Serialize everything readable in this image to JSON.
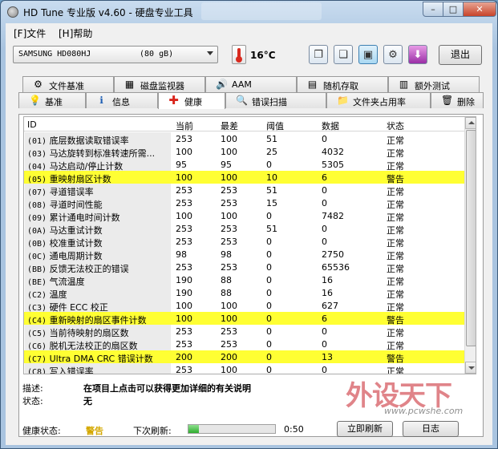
{
  "window": {
    "title": "HD Tune 专业版 v4.60 - 硬盘专业工具",
    "minimize": "–",
    "maximize": "□",
    "close": "✕"
  },
  "menu": [
    {
      "label": "[F]文件"
    },
    {
      "label": "[H]帮助"
    }
  ],
  "toolbar": {
    "drive": {
      "name": "SAMSUNG HD080HJ",
      "size": "(80 gB)"
    },
    "temperature": "16°C",
    "buttons": [
      {
        "name": "copy-text-icon",
        "glyph": "❐"
      },
      {
        "name": "copy-screenshot-icon",
        "glyph": "❏"
      },
      {
        "name": "save-icon",
        "glyph": "▣"
      },
      {
        "name": "options-icon",
        "glyph": "⚙"
      },
      {
        "name": "download-icon",
        "glyph": "⬇"
      }
    ],
    "exit_label": "退出"
  },
  "tabs_top": [
    {
      "label": "文件基准",
      "icon": "⚙"
    },
    {
      "label": "磁盘监视器",
      "icon": "▦"
    },
    {
      "label": "AAM",
      "icon": "🔊"
    },
    {
      "label": "随机存取",
      "icon": "▤"
    },
    {
      "label": "额外测试",
      "icon": "▥"
    }
  ],
  "tabs_bottom": [
    {
      "label": "基准",
      "icon": "💡"
    },
    {
      "label": "信息",
      "icon": "ℹ"
    },
    {
      "label": "健康",
      "icon": "✚"
    },
    {
      "label": "错误扫描",
      "icon": "🔍"
    },
    {
      "label": "文件夹占用率",
      "icon": "📁"
    },
    {
      "label": "删除",
      "icon": "🗑"
    }
  ],
  "colors": {
    "warning_row": "#ffff33",
    "health_warning_text": "#d4a800"
  },
  "table": {
    "headers": {
      "id": "ID",
      "current": "当前",
      "worst": "最差",
      "threshold": "阈值",
      "data": "数据",
      "status": "状态"
    },
    "rows": [
      {
        "id": "(01)",
        "name": "底层数据读取错误率",
        "current": "253",
        "worst": "100",
        "threshold": "51",
        "data": "0",
        "status": "正常",
        "warn": false
      },
      {
        "id": "(03)",
        "name": "马达旋转到标准转速所需...",
        "current": "100",
        "worst": "100",
        "threshold": "25",
        "data": "4032",
        "status": "正常",
        "warn": false
      },
      {
        "id": "(04)",
        "name": "马达启动/停止计数",
        "current": "95",
        "worst": "95",
        "threshold": "0",
        "data": "5305",
        "status": "正常",
        "warn": false
      },
      {
        "id": "(05)",
        "name": "重映射扇区计数",
        "current": "100",
        "worst": "100",
        "threshold": "10",
        "data": "6",
        "status": "警告",
        "warn": true
      },
      {
        "id": "(07)",
        "name": "寻道错误率",
        "current": "253",
        "worst": "253",
        "threshold": "51",
        "data": "0",
        "status": "正常",
        "warn": false
      },
      {
        "id": "(08)",
        "name": "寻道时间性能",
        "current": "253",
        "worst": "253",
        "threshold": "15",
        "data": "0",
        "status": "正常",
        "warn": false
      },
      {
        "id": "(09)",
        "name": "累计通电时间计数",
        "current": "100",
        "worst": "100",
        "threshold": "0",
        "data": "7482",
        "status": "正常",
        "warn": false
      },
      {
        "id": "(0A)",
        "name": "马达重试计数",
        "current": "253",
        "worst": "253",
        "threshold": "51",
        "data": "0",
        "status": "正常",
        "warn": false
      },
      {
        "id": "(0B)",
        "name": "校准重试计数",
        "current": "253",
        "worst": "253",
        "threshold": "0",
        "data": "0",
        "status": "正常",
        "warn": false
      },
      {
        "id": "(0C)",
        "name": "通电周期计数",
        "current": "98",
        "worst": "98",
        "threshold": "0",
        "data": "2750",
        "status": "正常",
        "warn": false
      },
      {
        "id": "(BB)",
        "name": "反馈无法校正的错误",
        "current": "253",
        "worst": "253",
        "threshold": "0",
        "data": "65536",
        "status": "正常",
        "warn": false
      },
      {
        "id": "(BE)",
        "name": "气流温度",
        "current": "190",
        "worst": "88",
        "threshold": "0",
        "data": "16",
        "status": "正常",
        "warn": false
      },
      {
        "id": "(C2)",
        "name": "温度",
        "current": "190",
        "worst": "88",
        "threshold": "0",
        "data": "16",
        "status": "正常",
        "warn": false
      },
      {
        "id": "(C3)",
        "name": "硬件 ECC 校正",
        "current": "100",
        "worst": "100",
        "threshold": "0",
        "data": "627",
        "status": "正常",
        "warn": false
      },
      {
        "id": "(C4)",
        "name": "重新映射的扇区事件计数",
        "current": "100",
        "worst": "100",
        "threshold": "0",
        "data": "6",
        "status": "警告",
        "warn": true
      },
      {
        "id": "(C5)",
        "name": "当前待映射的扇区数",
        "current": "253",
        "worst": "253",
        "threshold": "0",
        "data": "0",
        "status": "正常",
        "warn": false
      },
      {
        "id": "(C6)",
        "name": "脱机无法校正的扇区数",
        "current": "253",
        "worst": "253",
        "threshold": "0",
        "data": "0",
        "status": "正常",
        "warn": false
      },
      {
        "id": "(C7)",
        "name": "Ultra DMA CRC 错误计数",
        "current": "200",
        "worst": "200",
        "threshold": "0",
        "data": "13",
        "status": "警告",
        "warn": true
      },
      {
        "id": "(C8)",
        "name": "写入错误率",
        "current": "253",
        "worst": "100",
        "threshold": "0",
        "data": "0",
        "status": "正常",
        "warn": false
      }
    ]
  },
  "details": {
    "description_label": "描述:",
    "description_value": "在项目上点击可以获得更加详细的有关说明",
    "status_label": "状态:",
    "status_value": "无"
  },
  "footer": {
    "health_label": "健康状态:",
    "health_value": "警告",
    "refresh_label": "下次刷新:",
    "refresh_progress": 0.12,
    "countdown": "0:50",
    "refresh_now": "立即刷新",
    "log": "日志"
  },
  "watermark": {
    "logo": "外设天下",
    "url": "www.pcwshe.com"
  }
}
